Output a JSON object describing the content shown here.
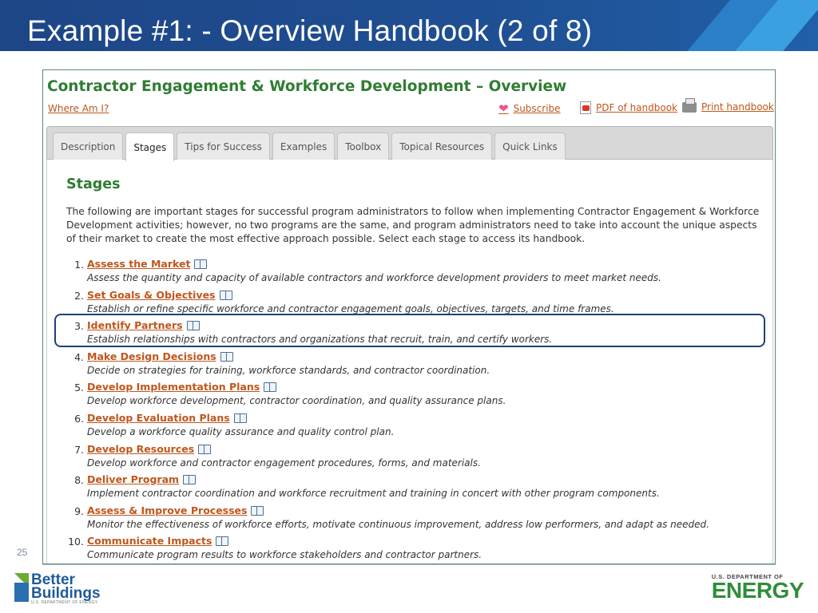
{
  "slide": {
    "title": "Example #1: - Overview Handbook (2 of 8)",
    "page_number": "25"
  },
  "screenshot": {
    "page_title": "Contractor Engagement & Workforce Development – Overview",
    "where_am_i": "Where Am I?",
    "utility_links": {
      "subscribe": "Subscribe",
      "pdf": "PDF of handbook",
      "print": "Print handbook"
    },
    "tabs": [
      {
        "label": "Description"
      },
      {
        "label": "Stages"
      },
      {
        "label": "Tips for Success"
      },
      {
        "label": "Examples"
      },
      {
        "label": "Toolbox"
      },
      {
        "label": "Topical Resources"
      },
      {
        "label": "Quick Links"
      }
    ],
    "active_tab": "Stages",
    "section_heading": "Stages",
    "intro": "The following are important stages for successful program administrators to follow when implementing Contractor Engagement & Workforce Development activities; however, no two programs are the same, and program administrators need to take into account the unique aspects of their market to create the most effective approach possible. Select each stage to access its handbook.",
    "stages": [
      {
        "num": "1.",
        "title": "Assess the Market",
        "desc": "Assess the quantity and capacity of available contractors and workforce development providers to meet market needs."
      },
      {
        "num": "2.",
        "title": "Set Goals & Objectives",
        "desc": "Establish or refine specific workforce and contractor engagement goals, objectives, targets, and time frames."
      },
      {
        "num": "3.",
        "title": "Identify Partners",
        "desc": "Establish relationships with contractors and organizations that recruit, train, and certify workers."
      },
      {
        "num": "4.",
        "title": "Make Design Decisions",
        "desc": "Decide on strategies for training, workforce standards, and contractor coordination."
      },
      {
        "num": "5.",
        "title": "Develop Implementation Plans",
        "desc": "Develop workforce development, contractor coordination, and quality assurance plans."
      },
      {
        "num": "6.",
        "title": "Develop Evaluation Plans",
        "desc": "Develop a workforce quality assurance and quality control plan."
      },
      {
        "num": "7.",
        "title": "Develop Resources",
        "desc": "Develop workforce and contractor engagement procedures, forms, and materials."
      },
      {
        "num": "8.",
        "title": "Deliver Program",
        "desc": "Implement contractor coordination and workforce recruitment and training in concert with other program components."
      },
      {
        "num": "9.",
        "title": "Assess & Improve Processes",
        "desc": "Monitor the effectiveness of workforce efforts, motivate continuous improvement, address low performers, and adapt as needed."
      },
      {
        "num": "10.",
        "title": "Communicate Impacts",
        "desc": "Communicate program results to workforce stakeholders and contractor partners."
      }
    ],
    "highlighted_stage": "3."
  },
  "footer": {
    "better_buildings": {
      "line1": "Better",
      "line2": "Buildings",
      "tagline": "U.S. DEPARTMENT OF ENERGY"
    },
    "doe": {
      "top": "U.S. DEPARTMENT OF",
      "bottom": "ENERGY"
    }
  },
  "colors": {
    "header_bg": "#1f4f93",
    "title_green": "#2e7d32",
    "link_orange": "#c0561c",
    "highlight_border": "#1f3f7a"
  }
}
